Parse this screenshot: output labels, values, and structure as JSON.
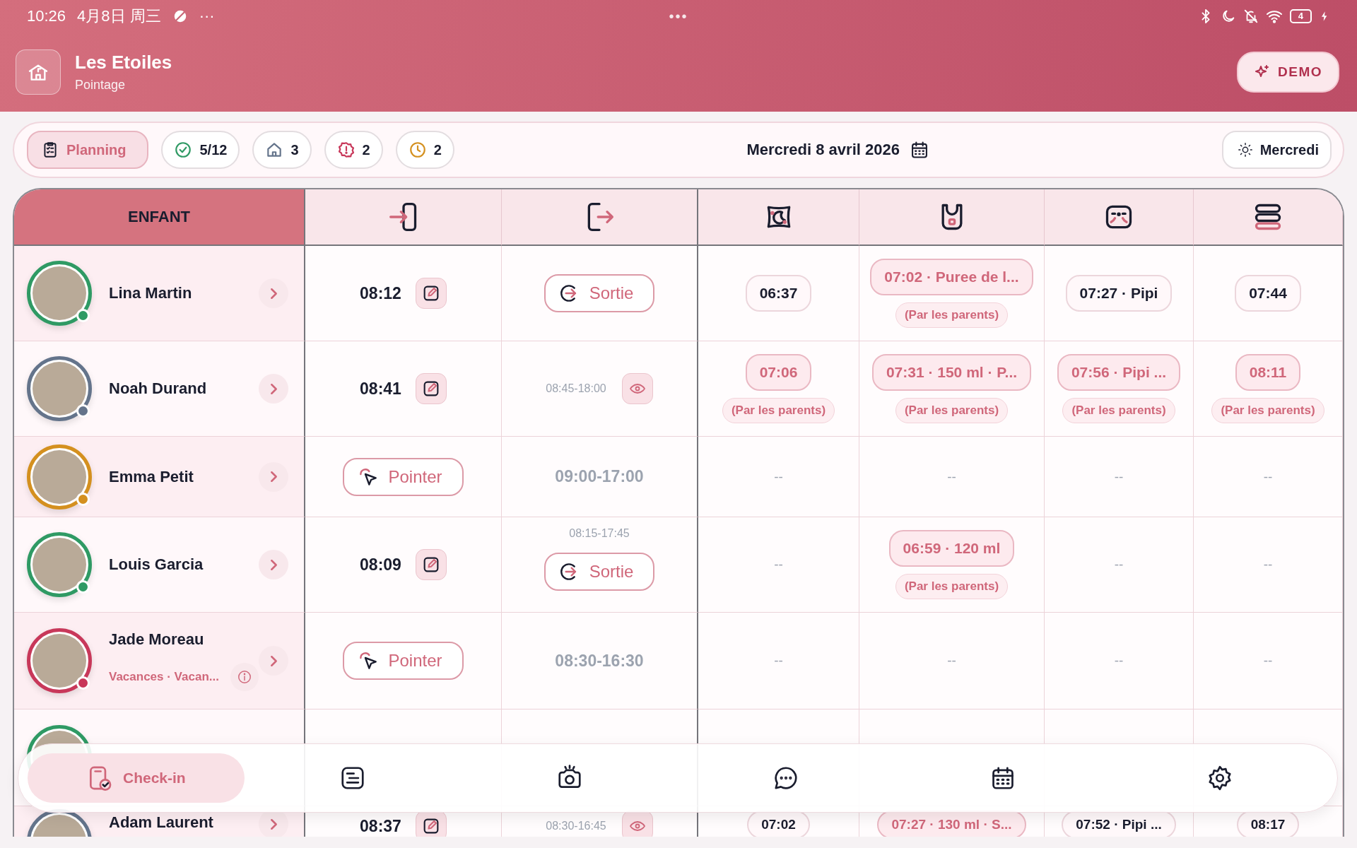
{
  "status_bar": {
    "time": "10:26",
    "date": "4月8日 周三",
    "more": "···",
    "center": "•••",
    "battery": "4"
  },
  "header": {
    "title": "Les Etoiles",
    "subtitle": "Pointage",
    "demo_button": "DEMO"
  },
  "toolbar": {
    "tabs": [
      {
        "label": "Planning",
        "selected": true
      }
    ],
    "counters": [
      {
        "kind": "present",
        "value": "5/12"
      },
      {
        "kind": "home",
        "value": "3"
      },
      {
        "kind": "alert",
        "value": "2"
      },
      {
        "kind": "pending",
        "value": "2"
      }
    ],
    "date": "Mercredi 8 avril 2026",
    "day_button": "Mercredi"
  },
  "table": {
    "columns": [
      {
        "kind": "child",
        "label": "ENFANT"
      },
      {
        "kind": "arrival"
      },
      {
        "kind": "departure"
      },
      {
        "kind": "sleep"
      },
      {
        "kind": "meal"
      },
      {
        "kind": "diaper"
      },
      {
        "kind": "stack"
      }
    ],
    "rows": [
      {
        "name": "Lina Martin",
        "color": "#2f9a64",
        "arrival": {
          "kind": "time",
          "time": "08:12"
        },
        "departure": {
          "kind": "button",
          "label": "Sortie"
        },
        "activities": [
          {
            "kind": "chip",
            "text": "06:37",
            "highlighted": false
          },
          {
            "kind": "chip",
            "text": "07:02 · Puree de l...",
            "highlighted": true,
            "note": "(Par les parents)"
          },
          {
            "kind": "chip",
            "text": "07:27 · Pipi",
            "highlighted": false
          },
          {
            "kind": "chip",
            "text": "07:44",
            "highlighted": false
          }
        ]
      },
      {
        "name": "Noah Durand",
        "color": "#64748b",
        "arrival": {
          "kind": "time",
          "time": "08:41"
        },
        "departure": {
          "kind": "schedule_view",
          "schedule": "08:45-18:00"
        },
        "activities": [
          {
            "kind": "chip",
            "text": "07:06",
            "highlighted": true,
            "note": "(Par les parents)"
          },
          {
            "kind": "chip",
            "text": "07:31 · 150 ml · P...",
            "highlighted": true,
            "note": "(Par les parents)"
          },
          {
            "kind": "chip",
            "text": "07:56 · Pipi ...",
            "highlighted": true,
            "note": "(Par les parents)"
          },
          {
            "kind": "chip",
            "text": "08:11",
            "highlighted": true,
            "note": "(Par les parents)"
          }
        ]
      },
      {
        "name": "Emma Petit",
        "color": "#d4901f",
        "arrival": {
          "kind": "button",
          "label": "Pointer"
        },
        "departure": {
          "kind": "schedule",
          "schedule": "09:00-17:00"
        },
        "activities": [
          {
            "kind": "empty",
            "text": "--"
          },
          {
            "kind": "empty",
            "text": "--"
          },
          {
            "kind": "empty",
            "text": "--"
          },
          {
            "kind": "empty",
            "text": "--"
          }
        ]
      },
      {
        "name": "Louis Garcia",
        "color": "#2f9a64",
        "arrival": {
          "kind": "time",
          "time": "08:09"
        },
        "departure": {
          "kind": "schedule_button",
          "schedule": "08:15-17:45",
          "label": "Sortie"
        },
        "activities": [
          {
            "kind": "empty",
            "text": "--"
          },
          {
            "kind": "chip",
            "text": "06:59 · 120 ml",
            "highlighted": true,
            "note": "(Par les parents)"
          },
          {
            "kind": "empty",
            "text": "--"
          },
          {
            "kind": "empty",
            "text": "--"
          }
        ]
      },
      {
        "name": "Jade Moreau",
        "subtitle": "Vacances · Vacan...",
        "color": "#c8385a",
        "arrival": {
          "kind": "button",
          "label": "Pointer"
        },
        "departure": {
          "kind": "schedule",
          "schedule": "08:30-16:30"
        },
        "activities": [
          {
            "kind": "empty",
            "text": "--"
          },
          {
            "kind": "empty",
            "text": "--"
          },
          {
            "kind": "empty",
            "text": "--"
          },
          {
            "kind": "empty",
            "text": "--"
          }
        ]
      },
      {
        "color": "#2f9a64"
      },
      {
        "name": "Adam Laurent",
        "color": "#64748b",
        "arrival": {
          "kind": "time",
          "time": "08:37"
        },
        "departure": {
          "kind": "schedule_view",
          "schedule": "08:30-16:45"
        },
        "activities": [
          {
            "kind": "chip",
            "text": "07:02",
            "highlighted": false
          },
          {
            "kind": "chip",
            "text": "07:27 · 130 ml · S...",
            "highlighted": true
          },
          {
            "kind": "chip",
            "text": "07:52 · Pipi ...",
            "highlighted": false
          },
          {
            "kind": "chip",
            "text": "08:17",
            "highlighted": false
          }
        ]
      }
    ]
  },
  "bottom_nav": [
    {
      "kind": "checkin",
      "label": "Check-in",
      "selected": true
    },
    {
      "kind": "notes",
      "selected": false
    },
    {
      "kind": "camera",
      "selected": false
    },
    {
      "kind": "chat",
      "selected": false
    },
    {
      "kind": "calendar",
      "selected": false
    },
    {
      "kind": "settings",
      "selected": false
    }
  ]
}
